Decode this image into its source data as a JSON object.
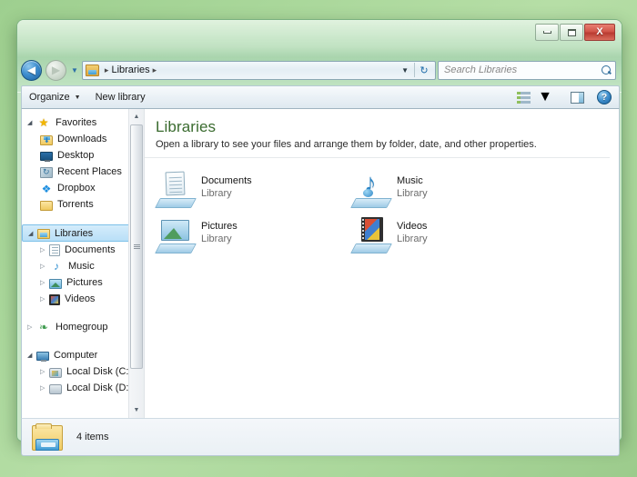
{
  "window": {
    "titlebar": {
      "minimize_label": "Minimize",
      "maximize_label": "Maximize",
      "close_label": "X"
    },
    "nav": {
      "back_arrow": "◀",
      "forward_arrow": "▶",
      "history_chevron": "▼",
      "refresh_glyph": "↻",
      "breadcrumb_sep_1": "▸",
      "breadcrumb_crumb": "Libraries",
      "breadcrumb_sep_2": "▸",
      "address_chevron": "▼"
    },
    "search": {
      "placeholder": "Search Libraries",
      "value": ""
    }
  },
  "toolbar": {
    "organize_label": "Organize",
    "organize_caret": "▼",
    "new_library_label": "New library",
    "view_caret": "▼",
    "help_glyph": "?"
  },
  "sidebar": {
    "scroll_up": "▲",
    "scroll_down": "▼",
    "groups": [
      {
        "header": {
          "label": "Favorites",
          "twisty": "◢",
          "icon": "star-icon"
        },
        "items": [
          {
            "label": "Downloads",
            "icon": "downloads-folder-icon"
          },
          {
            "label": "Desktop",
            "icon": "desktop-monitor-icon"
          },
          {
            "label": "Recent Places",
            "icon": "recent-places-icon"
          },
          {
            "label": "Dropbox",
            "icon": "dropbox-icon"
          },
          {
            "label": "Torrents",
            "icon": "folder-icon"
          }
        ]
      },
      {
        "header": {
          "label": "Libraries",
          "twisty": "◢",
          "icon": "libraries-folder-icon",
          "selected": true
        },
        "items": [
          {
            "label": "Documents",
            "icon": "documents-library-icon",
            "twisty": "▷"
          },
          {
            "label": "Music",
            "icon": "music-library-icon",
            "twisty": "▷"
          },
          {
            "label": "Pictures",
            "icon": "pictures-library-icon",
            "twisty": "▷"
          },
          {
            "label": "Videos",
            "icon": "videos-library-icon",
            "twisty": "▷"
          }
        ]
      },
      {
        "header": {
          "label": "Homegroup",
          "twisty": "▷",
          "icon": "homegroup-icon"
        },
        "items": []
      },
      {
        "header": {
          "label": "Computer",
          "twisty": "◢",
          "icon": "computer-icon"
        },
        "items": [
          {
            "label": "Local Disk (C:)",
            "icon": "windows-disk-icon",
            "twisty": "▷"
          },
          {
            "label": "Local Disk (D:)",
            "icon": "disk-icon",
            "twisty": "▷"
          }
        ]
      }
    ]
  },
  "content": {
    "title": "Libraries",
    "subtitle": "Open a library to see your files and arrange them by folder, date, and other properties.",
    "tiles": [
      {
        "name": "Documents",
        "type": "Library",
        "icon": "documents-library-icon"
      },
      {
        "name": "Music",
        "type": "Library",
        "icon": "music-library-icon"
      },
      {
        "name": "Pictures",
        "type": "Library",
        "icon": "pictures-library-icon"
      },
      {
        "name": "Videos",
        "type": "Library",
        "icon": "videos-library-icon"
      }
    ]
  },
  "statusbar": {
    "item_count": "4 items",
    "icon": "libraries-folder-icon"
  },
  "colors": {
    "title_green": "#3a6b2f",
    "selection_blue": "#b9dff7",
    "close_red": "#d2564a",
    "desktop_green": "#a9d79a"
  }
}
